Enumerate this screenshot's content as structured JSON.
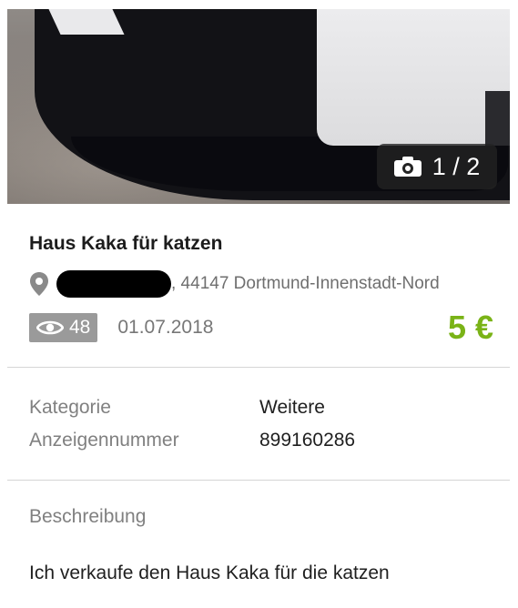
{
  "gallery": {
    "counter": "1 / 2",
    "icon": "camera-icon"
  },
  "listing": {
    "title": "Haus Kaka für katzen",
    "location": ", 44147 Dortmund-Innenstadt-Nord",
    "views": "48",
    "date": "01.07.2018",
    "price": "5 €"
  },
  "details": {
    "rows": [
      {
        "label": "Kategorie",
        "value": "Weitere"
      },
      {
        "label": "Anzeigennummer",
        "value": "899160286"
      }
    ]
  },
  "description": {
    "heading": "Beschreibung",
    "text": "Ich verkaufe den Haus Kaka für die katzen"
  },
  "colors": {
    "price": "#7ab317",
    "views_badge": "#9a9a9a",
    "divider": "#d5d5d5"
  },
  "icons": [
    "camera-icon",
    "location-pin-icon",
    "eye-icon"
  ]
}
